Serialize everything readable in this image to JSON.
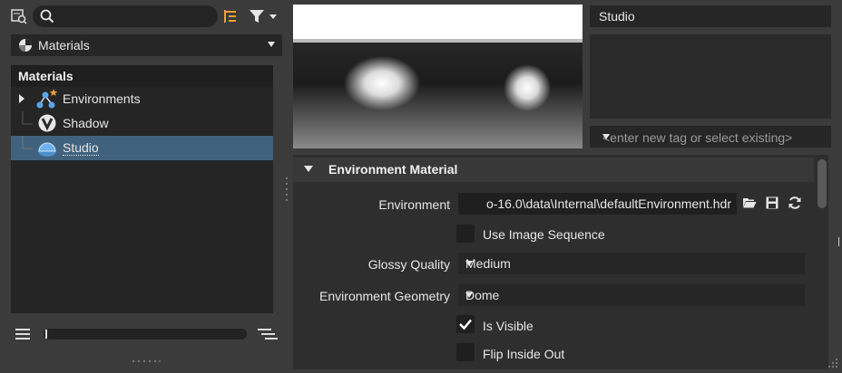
{
  "search": {
    "placeholder": ""
  },
  "library": {
    "selected": "Materials"
  },
  "tree": {
    "header": "Materials",
    "items": [
      {
        "label": "Environments"
      },
      {
        "label": "Shadow"
      },
      {
        "label": "Studio"
      }
    ]
  },
  "material_name": "Studio",
  "tags": {
    "placeholder": "<enter new tag or select existing>"
  },
  "section": {
    "title": "Environment Material"
  },
  "properties": {
    "environment_label": "Environment",
    "environment_value": "o-16.0\\data\\Internal\\defaultEnvironment.hdr",
    "use_image_sequence_label": "Use Image Sequence",
    "glossy_quality_label": "Glossy Quality",
    "glossy_quality_value": "Medium",
    "environment_geometry_label": "Environment Geometry",
    "environment_geometry_value": "Dome",
    "is_visible_label": "Is Visible",
    "flip_inside_out_label": "Flip Inside Out"
  },
  "colors": {
    "selection": "#41627e",
    "accent": "#f0a030"
  },
  "icons": [
    "search-view-icon",
    "search-icon",
    "tree-view-icon",
    "filter-icon",
    "environments-icon",
    "shadow-icon",
    "studio-icon",
    "open-folder-icon",
    "save-icon",
    "refresh-icon",
    "list-icon",
    "outline-icon",
    "checkmark-icon"
  ]
}
